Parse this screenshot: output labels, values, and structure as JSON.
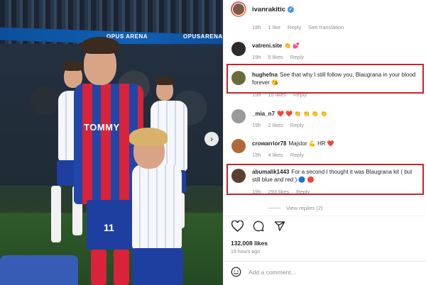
{
  "photo": {
    "banner_text": "OPUS ARENA",
    "banner_text_2": "OPUSARENA",
    "sponsor": "TOMMY",
    "shirt_number": "11",
    "next_label": "›"
  },
  "post": {
    "username": "ivanrakitic",
    "verified_mark": "✓",
    "caption_meta": {
      "time": "18h",
      "likes": "1 like",
      "reply": "Reply",
      "translate": "See translation"
    }
  },
  "comments": [
    {
      "user": "vatreni.site",
      "text": "👏 💕",
      "time": "19h",
      "likes": "5 likes",
      "reply": "Reply",
      "avatar_color": "#2c2c2c"
    },
    {
      "user": "hughefna",
      "text": "See that why I still follow you, Blaugrana in your blood forever 😘",
      "time": "19h",
      "likes": "15 likes",
      "reply": "Reply",
      "avatar_color": "#6b6b3a"
    },
    {
      "user": "_mia_n7",
      "text": "❤️ ❤️ 👏 👏 👏 👏",
      "time": "19h",
      "likes": "2 likes",
      "reply": "Reply",
      "avatar_color": "#9a9a9a"
    },
    {
      "user": "crowarrior78",
      "text": "Majstor 💪 HR ❤️",
      "time": "19h",
      "likes": "4 likes",
      "reply": "Reply",
      "avatar_color": "#b06a3a"
    },
    {
      "user": "abumalik1443",
      "text": "For a second I thought it was Blaugrana kit ( but still blue and red ) 🔵 🔴",
      "time": "19h",
      "likes": "293 likes",
      "reply": "Reply",
      "avatar_color": "#5a4030"
    }
  ],
  "view_replies": "View replies (2)",
  "footer": {
    "likes": "132,008 likes",
    "time_ago": "19 hours ago",
    "add_comment_placeholder": "Add a comment..."
  },
  "icons": {
    "heart": "heart-icon",
    "comment": "comment-icon",
    "share": "share-icon",
    "emoji": "emoji-icon"
  },
  "colors": {
    "highlight": "#c8242b",
    "verified": "#3897f0",
    "muted": "#8e8e8e"
  }
}
